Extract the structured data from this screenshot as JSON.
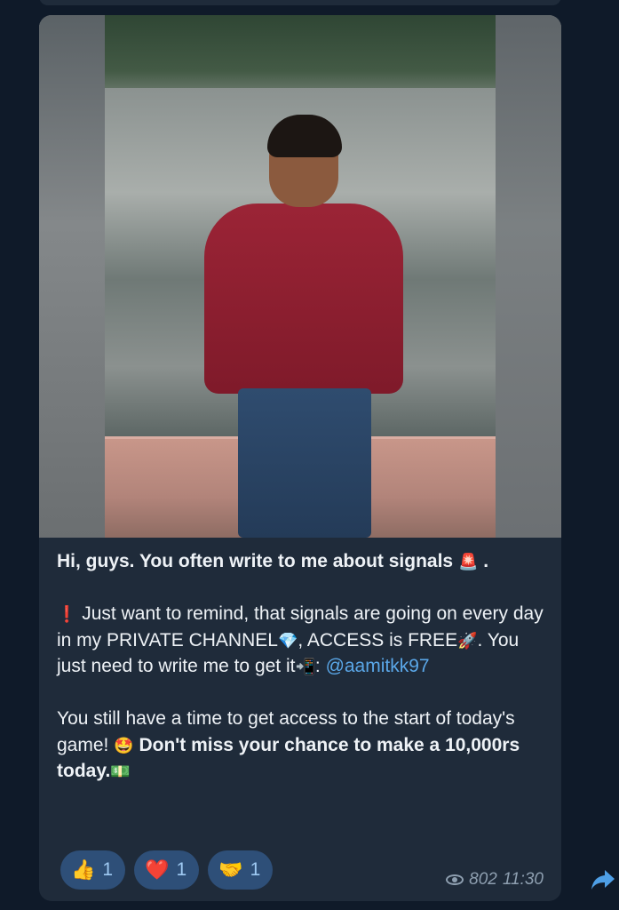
{
  "message": {
    "caption": {
      "line1": "Hi, guys. You often write to me about signals",
      "line1_emoji": "🚨",
      "line1_end": ".",
      "p2_emoji1": "❗",
      "p2_text1": " Just want to remind, that signals are going on every day in my PRIVATE CHANNEL",
      "p2_emoji2": "💎",
      "p2_text2": ", ACCESS is FREE",
      "p2_emoji3": "🚀",
      "p2_text3": ". You just need to write me to get it",
      "p2_emoji4": "📲",
      "p2_text4": ": ",
      "p2_link": "@aamitkk97",
      "p3_text1": "You still have a time to get access to the start of today's game! ",
      "p3_emoji1": "🤩",
      "p3_bold": " Don't miss your chance to make a 10,000rs today.",
      "p3_emoji2": "💵"
    },
    "reactions": [
      {
        "icon": "👍",
        "count": "1"
      },
      {
        "icon": "❤️",
        "count": "1"
      },
      {
        "icon": "🤝",
        "count": "1"
      }
    ],
    "views": "802",
    "time": "11:30"
  },
  "colors": {
    "background": "#0f1a29",
    "bubble": "#1f2b3a",
    "link": "#5aa7e8",
    "reaction_bg": "#2e4f78",
    "meta_text": "#8e9fb0"
  }
}
